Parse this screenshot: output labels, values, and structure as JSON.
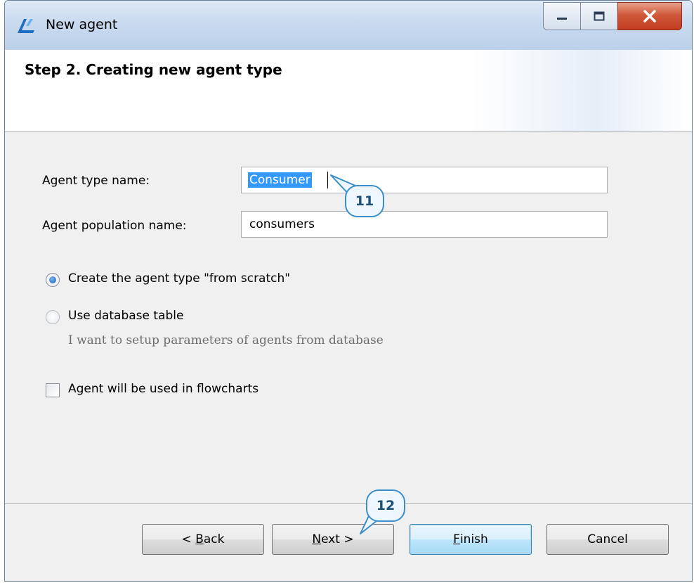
{
  "window": {
    "title": "New agent",
    "controls": {
      "minimize": "minimize",
      "maximize": "maximize",
      "close": "close"
    }
  },
  "header": {
    "step_title": "Step 2. Creating new agent type"
  },
  "form": {
    "agent_type_name": {
      "label": "Agent type name:",
      "value": "Consumer"
    },
    "agent_population_name": {
      "label": "Agent population name:",
      "value": "consumers"
    }
  },
  "options": {
    "from_scratch": {
      "label": "Create the agent type \"from scratch\"",
      "checked": true
    },
    "database_table": {
      "label": "Use database table",
      "hint": "I want to setup parameters of agents from database",
      "checked": false
    },
    "flowcharts": {
      "label": "Agent will be used in flowcharts",
      "checked": false
    }
  },
  "buttons": {
    "back": {
      "prefix": "< ",
      "mnemonic": "B",
      "rest": "ack"
    },
    "next": {
      "mnemonic": "N",
      "rest": "ext >"
    },
    "finish": {
      "mnemonic": "F",
      "rest": "inish"
    },
    "cancel": {
      "label": "Cancel"
    }
  },
  "callouts": {
    "first": "11",
    "second": "12"
  },
  "colors": {
    "accent": "#3399ff",
    "callout_border": "#3b8ec9",
    "close_button": "#c33b1f"
  },
  "icons": {
    "app": "anylogic-logo-icon",
    "minimize": "minimize-icon",
    "maximize": "maximize-icon",
    "close": "close-icon"
  }
}
